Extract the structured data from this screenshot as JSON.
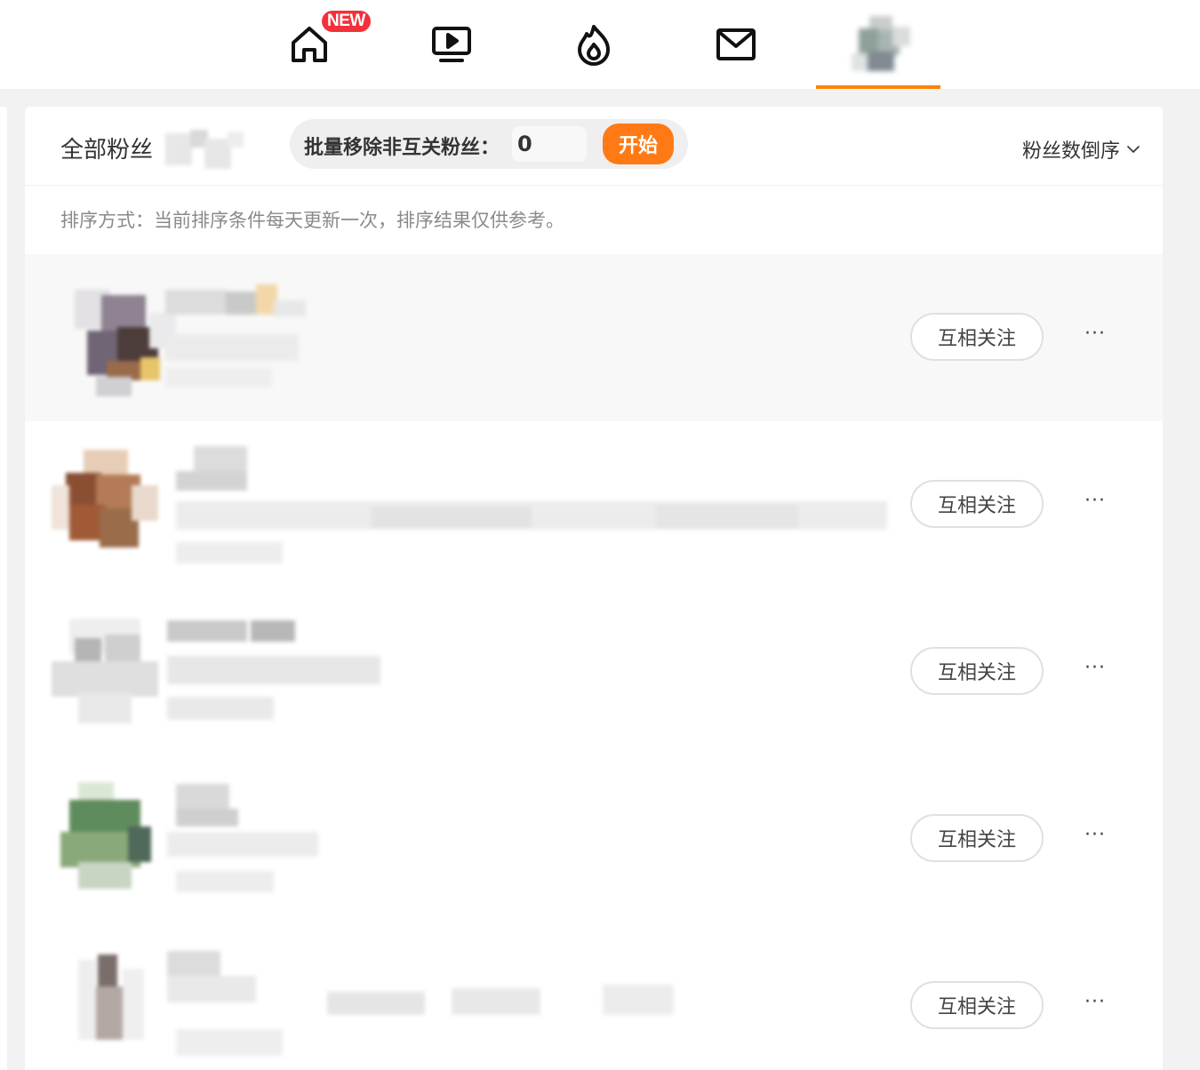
{
  "nav": {
    "new_badge": "NEW",
    "items": [
      {
        "icon": "home-icon"
      },
      {
        "icon": "video-icon"
      },
      {
        "icon": "hot-icon"
      },
      {
        "icon": "mail-icon"
      },
      {
        "icon": "avatar"
      }
    ],
    "accent": "#ff8200"
  },
  "header": {
    "all_fans": "全部粉丝",
    "batch_label": "批量移除非互关粉丝：",
    "batch_value": "0",
    "start_button": "开始",
    "sort_label": "粉丝数倒序"
  },
  "sort_note": "排序方式：当前排序条件每天更新一次，排序结果仅供参考。",
  "fans": [
    {
      "follow_label": "互相关注",
      "more": "···"
    },
    {
      "follow_label": "互相关注",
      "more": "···"
    },
    {
      "follow_label": "互相关注",
      "more": "···"
    },
    {
      "follow_label": "互相关注",
      "more": "···"
    },
    {
      "follow_label": "互相关注",
      "more": "···"
    }
  ]
}
